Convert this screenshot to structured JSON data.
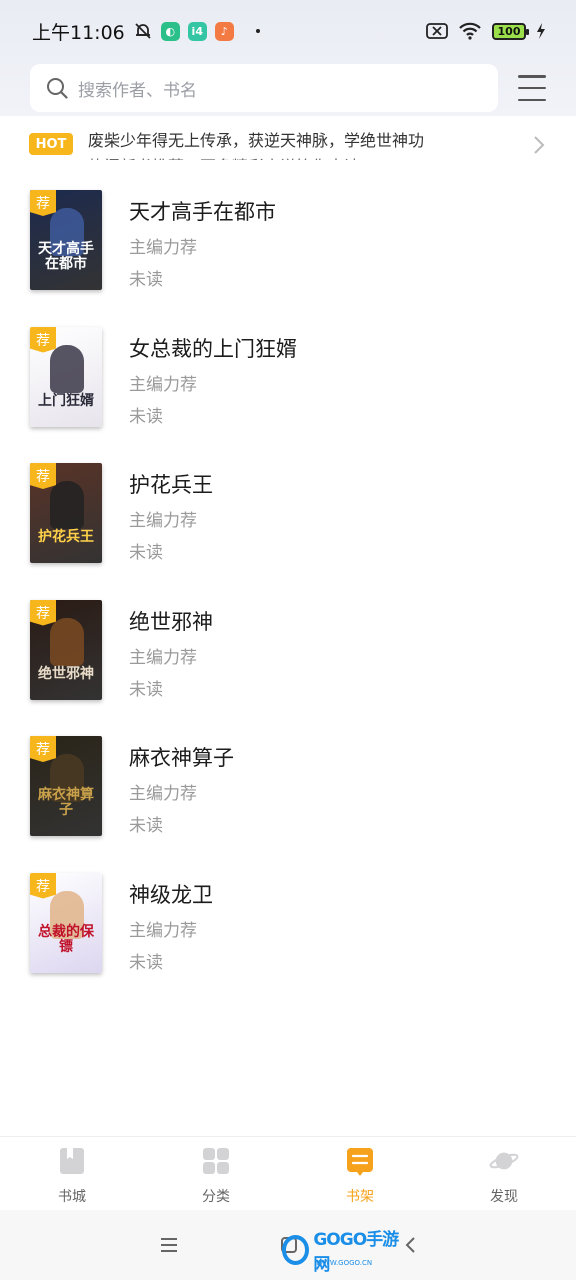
{
  "status_bar": {
    "time": "上午11:06",
    "battery": "100",
    "app_badges": [
      {
        "label": "◐",
        "color": "#2bbf8a"
      },
      {
        "label": "i4",
        "color": "#34c6a4"
      },
      {
        "label": "♪",
        "color": "#f47a43"
      }
    ]
  },
  "search": {
    "placeholder": "搜索作者、书名"
  },
  "notice": {
    "hot_label": "HOT",
    "text": "废柴少年得无上传承，获逆天神脉，学绝世神功",
    "next_text": "热门新书推荐，更多精彩小说等你来读"
  },
  "books": [
    {
      "title": "天才高手在都市",
      "tag": "荐",
      "subtitle": "主编力荐",
      "status": "未读",
      "cover_text": "天才高手在都市",
      "cover_bg": "#1c2a4e",
      "cover_color": "#ffffff",
      "figure_color": "#3e5a9c"
    },
    {
      "title": "女总裁的上门狂婿",
      "tag": "荐",
      "subtitle": "主编力荐",
      "status": "未读",
      "cover_text": "上门狂婿",
      "cover_bg": "#e7e4ec",
      "cover_color": "#2b2b3a",
      "figure_color": "#3a3648"
    },
    {
      "title": "护花兵王",
      "tag": "荐",
      "subtitle": "主编力荐",
      "status": "未读",
      "cover_text": "护花兵王",
      "cover_bg": "#5a3326",
      "cover_color": "#ffd24a",
      "figure_color": "#222222"
    },
    {
      "title": "绝世邪神",
      "tag": "荐",
      "subtitle": "主编力荐",
      "status": "未读",
      "cover_text": "绝世邪神",
      "cover_bg": "#2a1a14",
      "cover_color": "#e8dcc8",
      "figure_color": "#7a4a22"
    },
    {
      "title": "麻衣神算子",
      "tag": "荐",
      "subtitle": "主编力荐",
      "status": "未读",
      "cover_text": "麻衣神算子",
      "cover_bg": "#2a2418",
      "cover_color": "#c9a14a",
      "figure_color": "#4a3a22"
    },
    {
      "title": "神级龙卫",
      "tag": "荐",
      "subtitle": "主编力荐",
      "status": "未读",
      "cover_text": "总裁的保镖",
      "cover_bg": "#dcd6f0",
      "cover_color": "#c0122a",
      "figure_color": "#e0b48a"
    }
  ],
  "tabs": [
    {
      "label": "书城",
      "icon": "book-icon",
      "active": false
    },
    {
      "label": "分类",
      "icon": "grid-icon",
      "active": false
    },
    {
      "label": "书架",
      "icon": "bookshelf-icon",
      "active": true
    },
    {
      "label": "发现",
      "icon": "planet-icon",
      "active": false
    }
  ],
  "colors": {
    "accent": "#f7a21c",
    "hot_badge": "#f7b61c"
  },
  "watermark": {
    "text": "GOGO手游网",
    "url": "WWW.GOGO.CN"
  }
}
